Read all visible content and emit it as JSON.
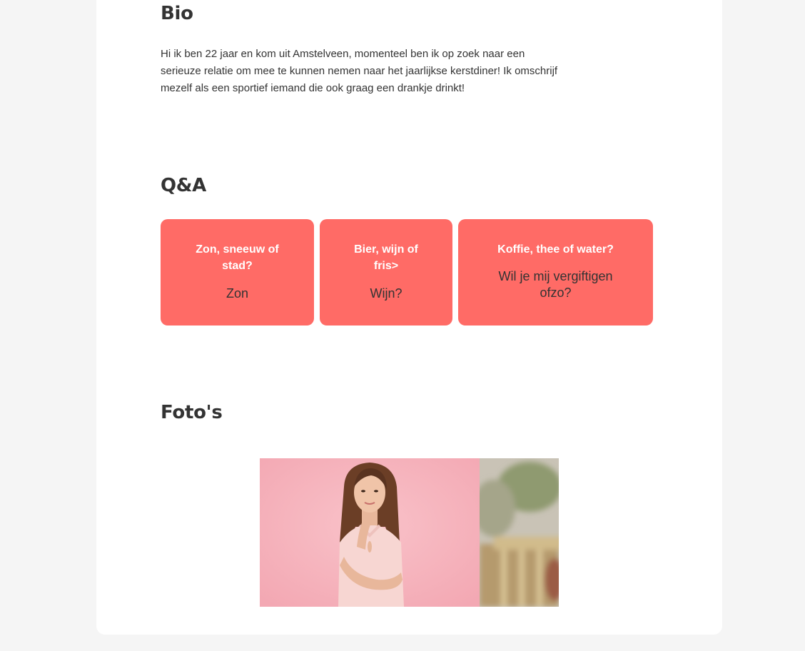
{
  "bio": {
    "title": "Bio",
    "text": "Hi ik ben 22 jaar en kom uit Amstelveen, momenteel ben ik op zoek naar een serieuze relatie om mee te kunnen nemen naar het jaarlijkse kerstdiner! Ik omschrijf mezelf als een sportief iemand die ook graag een drankje drinkt!"
  },
  "qa": {
    "title": "Q&A",
    "items": [
      {
        "question": "Zon, sneeuw of stad?",
        "answer": "Zon"
      },
      {
        "question": "Bier, wijn of fris>",
        "answer": "Wijn?"
      },
      {
        "question": "Koffie, thee of water?",
        "answer": "Wil je mij vergiftigen ofzo?"
      }
    ]
  },
  "photos": {
    "title": "Foto's",
    "items": [
      {
        "icon": "woman-portrait-photo"
      },
      {
        "icon": "outdoor-blurred-photo"
      }
    ]
  },
  "colors": {
    "background": "#f5f5f5",
    "card": "#ffffff",
    "accent": "#ff6b66",
    "text": "#333333"
  }
}
